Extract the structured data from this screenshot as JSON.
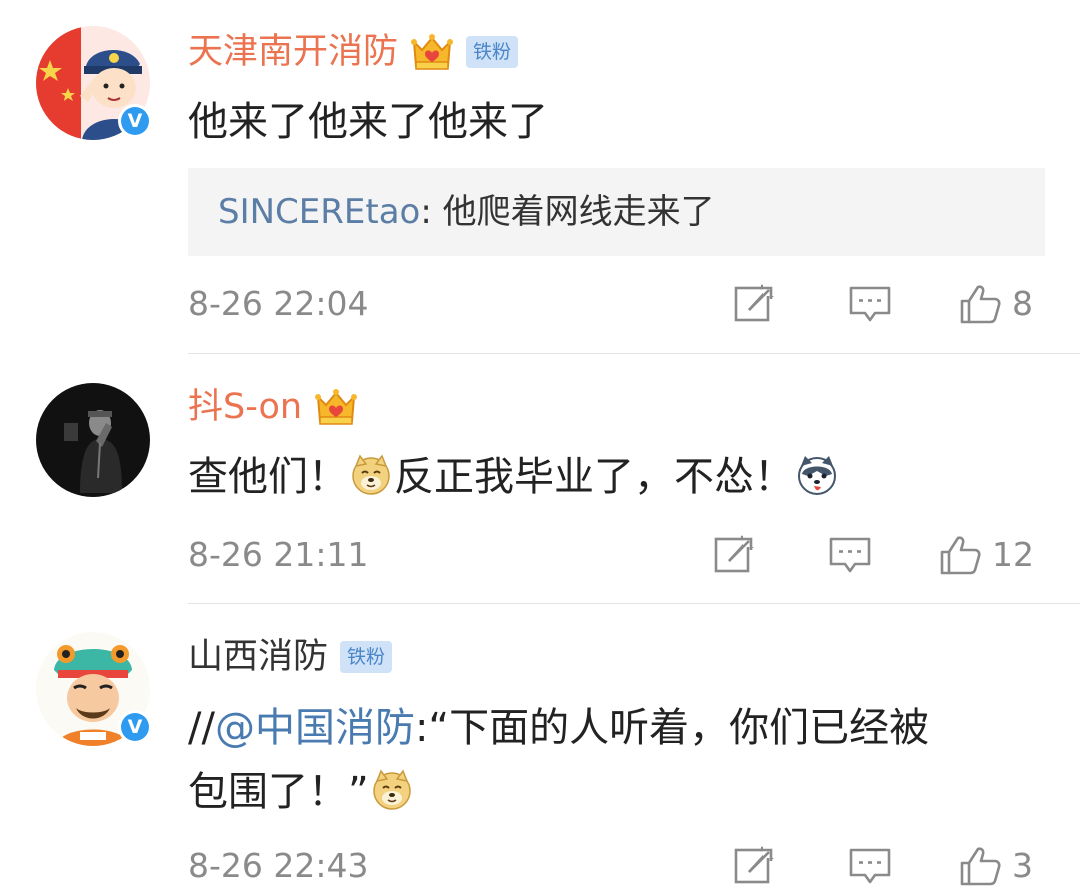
{
  "comments": [
    {
      "username": "天津南开消防",
      "fan_badge": "铁粉",
      "body": "他来了他来了他来了",
      "quote": {
        "author": "SINCEREtao",
        "separator": ": ",
        "text": "他爬着网线走来了"
      },
      "timestamp": "8-26 22:04",
      "like_count": "8"
    },
    {
      "username": "抖S-on",
      "body_part1": "查他们！",
      "body_part2": "反正我毕业了，不怂！",
      "emoji1": "doge-emoji",
      "emoji2": "husky-emoji",
      "timestamp": "8-26 21:11",
      "like_count": "12"
    },
    {
      "username": "山西消防",
      "fan_badge": "铁粉",
      "body_prefix": "//",
      "mention": "@中国消防",
      "body_line1": ":“下面的人听着，你们已经被",
      "body_line2": "包围了！”",
      "emoji": "doge-emoji",
      "timestamp": "8-26 22:43",
      "like_count": "3"
    }
  ],
  "colors": {
    "vip_name": "#eb7350",
    "link": "#4a7bb0",
    "meta_gray": "#8a8a8a",
    "verified_blue": "#2f9bf0",
    "badge_bg": "#cfe2f7"
  },
  "icons": {
    "repost": "repost-icon",
    "comment": "comment-icon",
    "like": "like-icon",
    "crown": "vip-crown-icon",
    "verified": "verified-icon"
  }
}
